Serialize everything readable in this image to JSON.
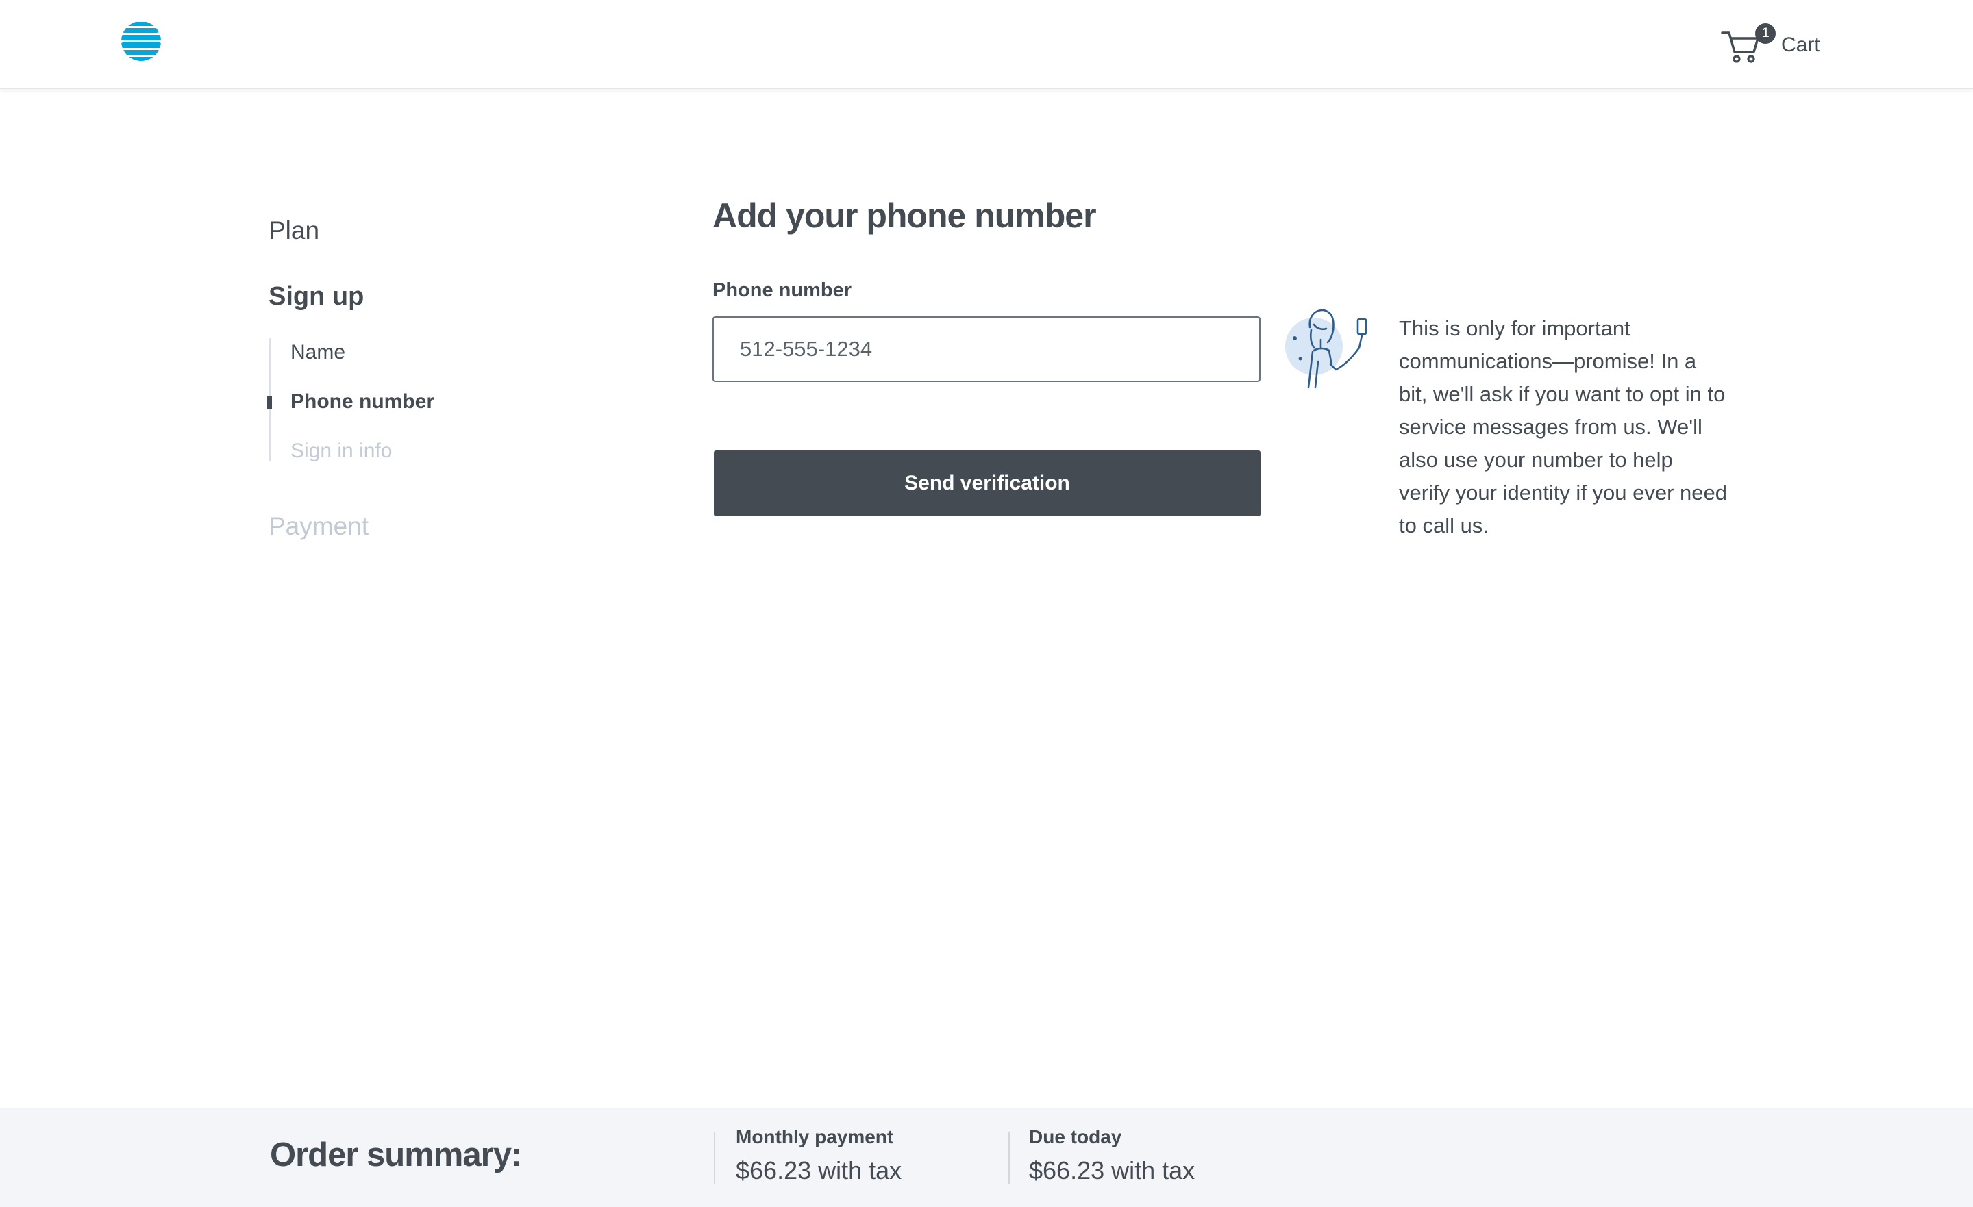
{
  "header": {
    "logo_alt": "AT&T",
    "cart": {
      "label": "Cart",
      "count": "1"
    }
  },
  "progress": {
    "steps": [
      {
        "label": "Plan",
        "state": "done"
      },
      {
        "label": "Sign up",
        "state": "current"
      },
      {
        "label": "Payment",
        "state": "upcoming"
      }
    ],
    "substeps": [
      {
        "label": "Name",
        "state": "done"
      },
      {
        "label": "Phone number",
        "state": "current"
      },
      {
        "label": "Sign in info",
        "state": "upcoming"
      }
    ]
  },
  "form": {
    "title": "Add your phone number",
    "phone_label": "Phone number",
    "phone_value": "512-555-1234",
    "submit_label": "Send verification"
  },
  "info": {
    "text": "This is only for important communications—promise! In a bit, we'll ask if you want to opt in to service messages from us. We'll also use your number to help verify your identity if you ever need to call us."
  },
  "order_summary": {
    "title": "Order summary:",
    "monthly": {
      "label": "Monthly payment",
      "amount": "$66.23 with tax"
    },
    "due_today": {
      "label": "Due today",
      "amount": "$66.23 with tax"
    }
  },
  "colors": {
    "brand_blue": "#00a8e0",
    "dark_gray": "#454b52",
    "disabled_gray": "#c3cad3",
    "footer_bg": "#f3f5f9"
  }
}
